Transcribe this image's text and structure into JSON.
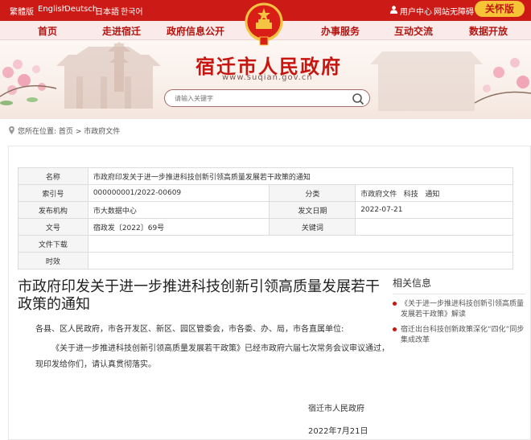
{
  "topbar": {
    "languages": [
      "繁體版",
      "English",
      "Deutsch",
      "日本語",
      "한국어"
    ],
    "user_center": "用户中心",
    "accessibility": "网站无障碍",
    "care_mode": "关怀版"
  },
  "nav": {
    "items": [
      "首页",
      "走进宿迁",
      "政府信息公开",
      "办事服务",
      "互动交流",
      "数据开放"
    ]
  },
  "banner": {
    "title": "宿迁市人民政府",
    "url": "www.suqian.gov.cn"
  },
  "search": {
    "placeholder": "请输入关键字"
  },
  "breadcrumb": {
    "label": "您所在位置:",
    "home": "首页",
    "sep": ">",
    "current": "市政府文件"
  },
  "info": {
    "name_label": "名称",
    "name_value": "市政府印发关于进一步推进科技创新引领高质量发展若干政策的通知",
    "index_label": "索引号",
    "index_value": "000000001/2022-00609",
    "category_label": "分类",
    "category_value": "市政府文件   科技   通知",
    "org_label": "发布机构",
    "org_value": "市大数据中心",
    "date_label": "发文日期",
    "date_value": "2022-07-21",
    "docno_label": "文号",
    "docno_value": "宿政发〔2022〕69号",
    "keywords_label": "关键词",
    "keywords_value": "",
    "download_label": "文件下载",
    "download_value": "",
    "validity_label": "时效",
    "validity_value": ""
  },
  "article": {
    "title": "市政府印发关于进一步推进科技创新引领高质量发展若干政策的通知",
    "salutation": "各县、区人民政府，市各开发区、新区、园区管委会，市各委、办、局，市各直属单位:",
    "body": "《关于进一步推进科技创新引领高质量发展若干政策》已经市政府六届七次常务会议审议通过，现印发给你们，请认真贯彻落实。",
    "signature": "宿迁市人民政府",
    "date": "2022年7月21日"
  },
  "related": {
    "title": "相关信息",
    "items": [
      "《关于进一步推进科技创新引领高质量发展若干政策》解读",
      "宿迁出台科技创新政策深化“四化”同步集成改革"
    ]
  },
  "colors": {
    "brand_red": "#cc1b16",
    "care_yellow": "#f7c437"
  }
}
